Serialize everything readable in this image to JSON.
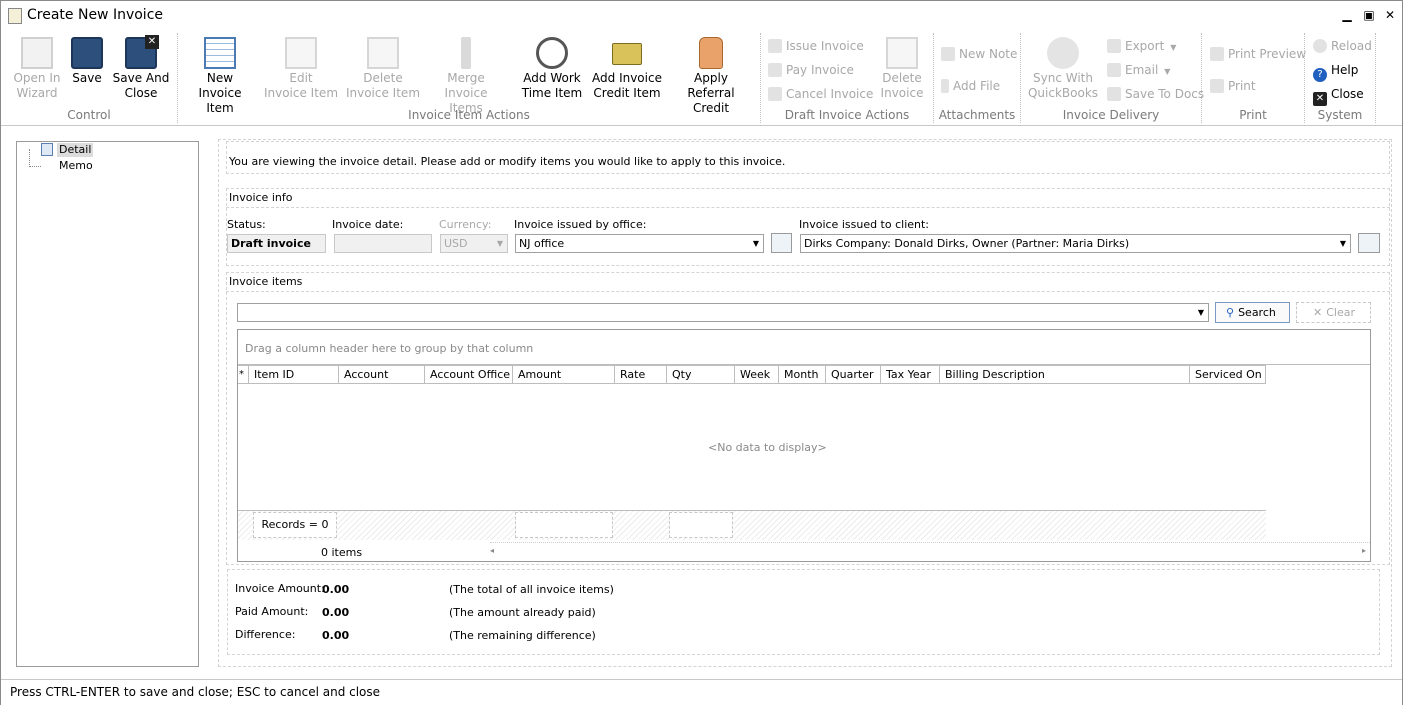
{
  "window": {
    "title": "Create New Invoice"
  },
  "ribbon": {
    "control": {
      "group_label": "Control",
      "open_in_wizard": "Open In\nWizard",
      "save": "Save",
      "save_and_close": "Save And\nClose"
    },
    "item_actions": {
      "group_label": "Invoice Item Actions",
      "new_item": "New\nInvoice Item",
      "edit_item": "Edit\nInvoice Item",
      "delete_item": "Delete\nInvoice Item",
      "merge_items": "Merge\nInvoice Items",
      "add_work_time": "Add Work\nTime Item",
      "add_credit": "Add Invoice\nCredit Item",
      "apply_referral": "Apply Referral\nCredit"
    },
    "draft_actions": {
      "group_label": "Draft Invoice Actions",
      "issue_invoice": "Issue Invoice",
      "pay_invoice": "Pay Invoice",
      "cancel_invoice": "Cancel Invoice",
      "delete_invoice": "Delete\nInvoice"
    },
    "attachments": {
      "group_label": "Attachments",
      "new_note": "New Note",
      "add_file": "Add File"
    },
    "delivery": {
      "group_label": "Invoice Delivery",
      "sync_quickbooks": "Sync With\nQuickBooks",
      "export": "Export",
      "email": "Email",
      "save_to_docs": "Save To Docs"
    },
    "print": {
      "group_label": "Print",
      "print_preview": "Print Preview",
      "print": "Print"
    },
    "system": {
      "group_label": "System",
      "reload": "Reload",
      "help": "Help",
      "close": "Close"
    }
  },
  "tree": {
    "items": [
      "Detail",
      "Memo"
    ]
  },
  "info_message": "You are viewing the invoice detail. Please add or modify items you would like to apply to this invoice.",
  "invoice_info": {
    "section_title": "Invoice info",
    "status_label": "Status:",
    "status_value": "Draft invoice",
    "date_label": "Invoice date:",
    "date_value": "",
    "currency_label": "Currency:",
    "currency_value": "USD",
    "office_label": "Invoice issued by office:",
    "office_value": "NJ office",
    "client_label": "Invoice issued to client:",
    "client_value": "Dirks Company: Donald Dirks, Owner (Partner: Maria Dirks)"
  },
  "invoice_items": {
    "section_title": "Invoice items",
    "search_button": "Search",
    "clear_button": "Clear",
    "group_hint": "Drag a column header here to group by that column",
    "columns": [
      "Item ID",
      "Account",
      "Account Office",
      "Amount",
      "Rate",
      "Qty",
      "Week",
      "Month",
      "Quarter",
      "Tax Year",
      "Billing Description",
      "Serviced On"
    ],
    "new_row_marker": "*",
    "empty_text": "<No data to display>",
    "records_summary": "Records = 0",
    "items_count": "0 items"
  },
  "totals": {
    "invoice_amount_label": "Invoice Amount:",
    "invoice_amount_value": "0.00",
    "invoice_amount_desc": "(The total of all invoice items)",
    "paid_amount_label": "Paid Amount:",
    "paid_amount_value": "0.00",
    "paid_amount_desc": "(The amount already paid)",
    "difference_label": "Difference:",
    "difference_value": "0.00",
    "difference_desc": "(The remaining difference)"
  },
  "status_bar": "Press CTRL-ENTER to save and close; ESC to cancel and close"
}
